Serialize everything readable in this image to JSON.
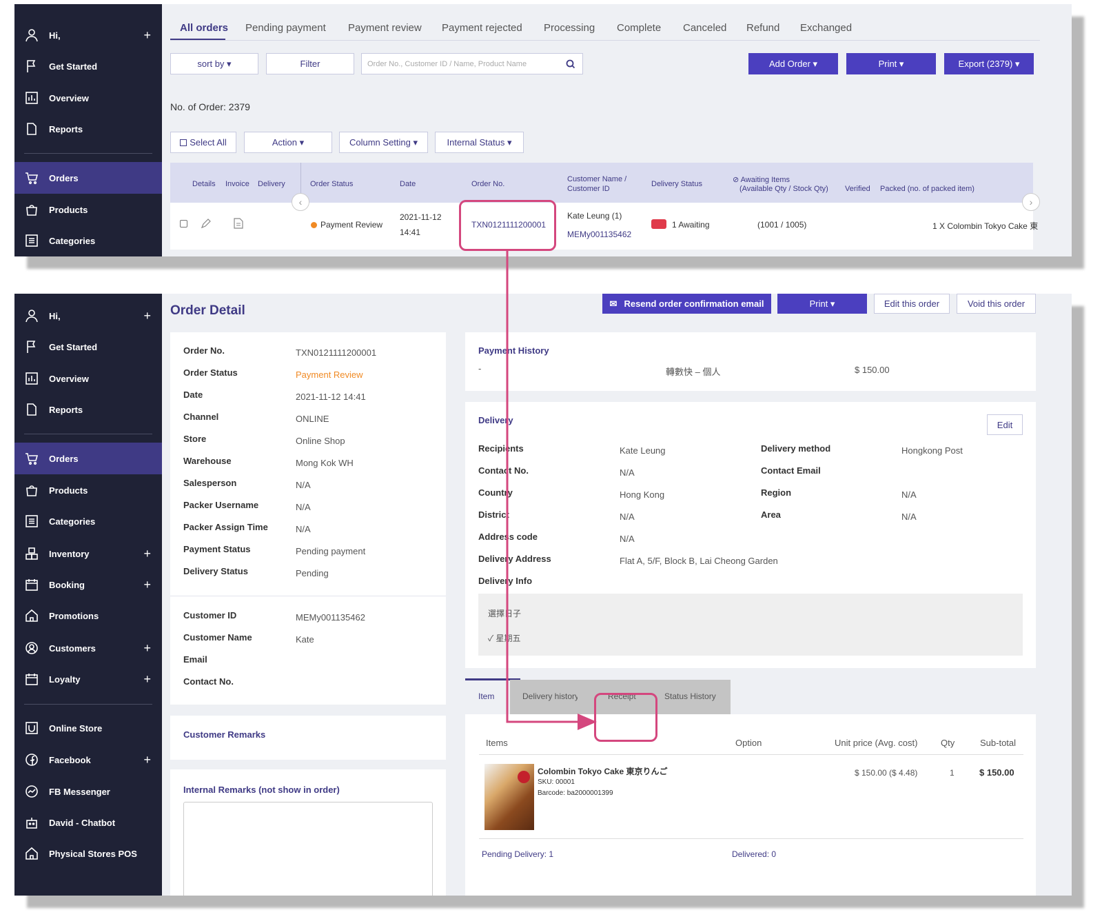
{
  "sidebar": {
    "hi": "Hi,",
    "items": [
      {
        "label": "Get Started",
        "icon": "flag-icon"
      },
      {
        "label": "Overview",
        "icon": "chart-icon"
      },
      {
        "label": "Reports",
        "icon": "document-icon"
      },
      {
        "label": "Orders",
        "icon": "cart-icon"
      },
      {
        "label": "Products",
        "icon": "bag-icon"
      },
      {
        "label": "Categories",
        "icon": "list-icon"
      },
      {
        "label": "Inventory",
        "icon": "boxes-icon",
        "plus": "+"
      },
      {
        "label": "Booking",
        "icon": "calendar-icon",
        "plus": "+"
      },
      {
        "label": "Promotions",
        "icon": "home-icon"
      },
      {
        "label": "Customers",
        "icon": "user-circle-icon",
        "plus": "+"
      },
      {
        "label": "Loyalty",
        "icon": "calendar-icon",
        "plus": "+"
      },
      {
        "label": "Online Store",
        "icon": "store-icon"
      },
      {
        "label": "Facebook",
        "icon": "facebook-icon",
        "plus": "+"
      },
      {
        "label": "FB Messenger",
        "icon": "messenger-icon"
      },
      {
        "label": "David - Chatbot",
        "icon": "robot-icon"
      },
      {
        "label": "Physical Stores POS",
        "icon": "home-icon"
      }
    ],
    "plus": "+"
  },
  "orders": {
    "tabs": [
      "All orders",
      "Pending payment",
      "Payment review",
      "Payment rejected",
      "Processing",
      "Complete",
      "Canceled",
      "Refund",
      "Exchanged"
    ],
    "sort_by": "sort by ▾",
    "filter": "Filter",
    "search_placeholder": "Order No., Customer ID / Name, Product Name",
    "add_order": "Add Order ▾",
    "print": "Print ▾",
    "export": "Export (2379) ▾",
    "count": "No. of Order: 2379",
    "select_all": "Select All",
    "action": "Action ▾",
    "column_setting": "Column Setting ▾",
    "internal_status": "Internal Status ▾",
    "headers": {
      "details": "Details",
      "invoice": "Invoice",
      "delivery": "Delivery",
      "order_status": "Order Status",
      "date": "Date",
      "order_no": "Order No.",
      "customer_name": "Customer Name /",
      "customer_id": "Customer ID",
      "delivery_status": "Delivery Status",
      "awaiting_items": "Awaiting Items",
      "awaiting_sub": "(Available Qty / Stock Qty)",
      "verified": "Verified",
      "packed": "Packed (no. of packed item)"
    },
    "row": {
      "status": "Payment Review",
      "date1": "2021-11-12",
      "date2": "14:41",
      "order_no": "TXN0121111200001",
      "customer_name": "Kate Leung (1)",
      "customer_id": "MEMy001135462",
      "delivery_status": "1 Awaiting",
      "awaiting": "(1001 / 1005)",
      "items": "1 X Colombin Tokyo Cake 東"
    },
    "status_color": "#f08a24"
  },
  "detail": {
    "title": "Order Detail",
    "resend": "Resend order confirmation email",
    "print": "Print ▾",
    "edit_order": "Edit this order",
    "void_order": "Void this order",
    "fields": [
      {
        "label": "Order No.",
        "value": "TXN0121111200001"
      },
      {
        "label": "Order Status",
        "value": "Payment Review"
      },
      {
        "label": "Date",
        "value": "2021-11-12 14:41"
      },
      {
        "label": "Channel",
        "value": "ONLINE"
      },
      {
        "label": "Store",
        "value": "Online Shop"
      },
      {
        "label": "Warehouse",
        "value": "Mong Kok WH"
      },
      {
        "label": "Salesperson",
        "value": "N/A"
      },
      {
        "label": "Packer Username",
        "value": "N/A"
      },
      {
        "label": "Packer Assign Time",
        "value": "N/A"
      },
      {
        "label": "Payment Status",
        "value": "Pending payment"
      },
      {
        "label": "Delivery Status",
        "value": "Pending"
      }
    ],
    "customer_fields": [
      {
        "label": "Customer ID",
        "value": "MEMy001135462"
      },
      {
        "label": "Customer Name",
        "value": "Kate"
      },
      {
        "label": "Email",
        "value": ""
      },
      {
        "label": "Contact No.",
        "value": ""
      }
    ],
    "customer_remarks": "Customer Remarks",
    "internal_remarks": "Internal Remarks (not show in order)",
    "payment_history": {
      "title": "Payment History",
      "dash": "-",
      "method": "轉數快 – 個人",
      "amount": "$ 150.00"
    },
    "delivery": {
      "title": "Delivery",
      "edit": "Edit",
      "left": [
        {
          "label": "Recipients",
          "value": "Kate Leung"
        },
        {
          "label": "Contact No.",
          "value": "N/A"
        },
        {
          "label": "Country",
          "value": "Hong Kong"
        },
        {
          "label": "District",
          "value": "N/A"
        },
        {
          "label": "Address code",
          "value": "N/A"
        },
        {
          "label": "Delivery Address",
          "value": "Flat A, 5/F, Block B, Lai Cheong Garden"
        },
        {
          "label": "Delivery Info",
          "value": ""
        }
      ],
      "right": [
        {
          "label": "Delivery method",
          "value": "Hongkong Post"
        },
        {
          "label": "Contact Email",
          "value": ""
        },
        {
          "label": "Region",
          "value": "N/A"
        },
        {
          "label": "Area",
          "value": "N/A"
        }
      ],
      "info_title": "選擇日子",
      "info_value": "✓ 星期五"
    },
    "tabs": [
      "Item",
      "Delivery history",
      "Receipt",
      "Status History"
    ],
    "items_table": {
      "headers": [
        "Items",
        "Option",
        "Unit price (Avg. cost)",
        "Qty",
        "Sub-total"
      ],
      "name": "Colombin Tokyo Cake 東京りんご",
      "sku": "SKU: 00001",
      "barcode": "Barcode: ba2000001399",
      "unit_price": "$ 150.00 ($ 4.48)",
      "qty": "1",
      "subtotal": "$ 150.00"
    },
    "pending_delivery": "Pending Delivery: 1",
    "delivered": "Delivered: 0"
  },
  "colors": {
    "accent": "#3f3a85",
    "highlight": "#d4477e",
    "sidebar": "#1f2236",
    "button": "#4b3fbf"
  }
}
